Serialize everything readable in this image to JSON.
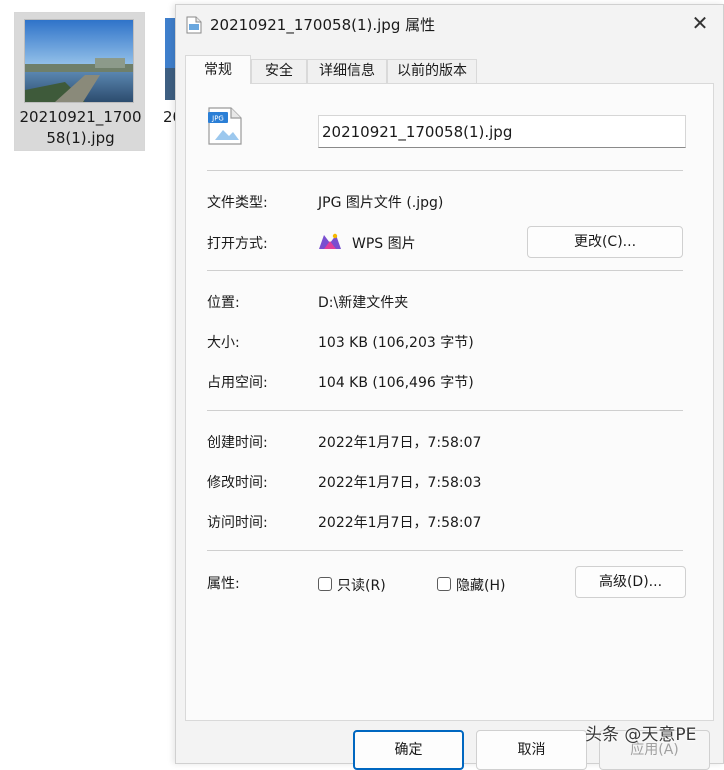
{
  "explorer": {
    "file1_name": "20210921_170058(1).jpg",
    "file2_name_partial": "20"
  },
  "dialog": {
    "title": "20210921_170058(1).jpg 属性",
    "close_glyph": "✕",
    "tabs": [
      {
        "label": "常规",
        "active": true
      },
      {
        "label": "安全",
        "active": false
      },
      {
        "label": "详细信息",
        "active": false
      },
      {
        "label": "以前的版本",
        "active": false
      }
    ],
    "file_icon_text": "JPG",
    "file_name_value": "20210921_170058(1).jpg",
    "type_label": "文件类型:",
    "type_value": "JPG 图片文件 (.jpg)",
    "open_with_label": "打开方式:",
    "open_with_value": "WPS 图片",
    "change_button": "更改(C)...",
    "location_label": "位置:",
    "location_value": "D:\\新建文件夹",
    "size_label": "大小:",
    "size_value": "103 KB (106,203 字节)",
    "size_on_disk_label": "占用空间:",
    "size_on_disk_value": "104 KB (106,496 字节)",
    "created_label": "创建时间:",
    "created_value": "2022年1月7日，7:58:07",
    "modified_label": "修改时间:",
    "modified_value": "2022年1月7日，7:58:03",
    "accessed_label": "访问时间:",
    "accessed_value": "2022年1月7日，7:58:07",
    "attributes_label": "属性:",
    "readonly_label": "只读(R)",
    "hidden_label": "隐藏(H)",
    "advanced_button": "高级(D)...",
    "ok_button": "确定",
    "cancel_button": "取消",
    "apply_button": "应用(A)"
  },
  "watermark": "头条 @天意PE",
  "colors": {
    "accent": "#0067c0",
    "dialog_bg": "#f3f3f3",
    "panel_bg": "#fbfbfb",
    "wps_icon": "#e0409a"
  }
}
